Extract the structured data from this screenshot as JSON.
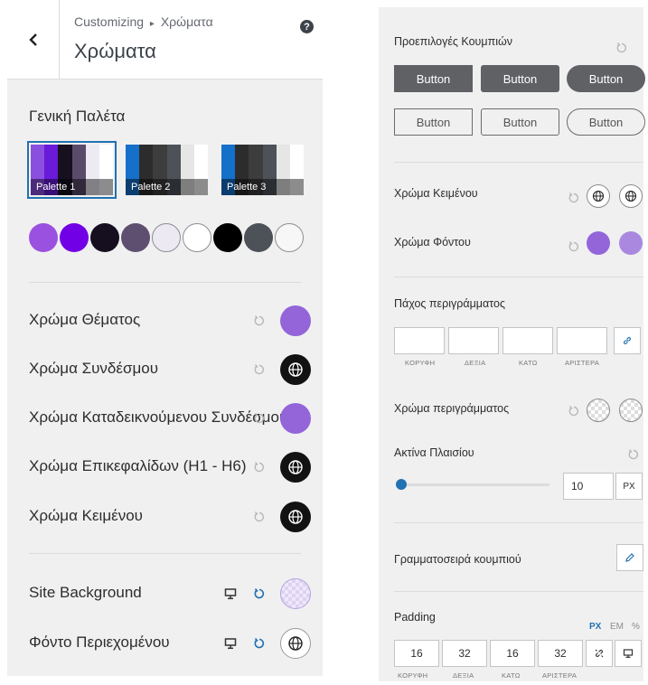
{
  "left": {
    "breadcrumb_root": "Customizing",
    "breadcrumb_sep": "▸",
    "breadcrumb_current": "Χρώματα",
    "title": "Χρώματα",
    "help": "?",
    "palette_section_title": "Γενική Παλέτα",
    "palettes": [
      {
        "label": "Palette 1",
        "colors": [
          "#8b4fe0",
          "#6a1ad9",
          "#16101f",
          "#5a4b6b",
          "#eeeaf3",
          "#ffffff"
        ],
        "selected": true
      },
      {
        "label": "Palette 2",
        "colors": [
          "#1570c9",
          "#2c2c2c",
          "#3d3d3d",
          "#4d5259",
          "#e6e6e6",
          "#ffffff"
        ],
        "selected": false
      },
      {
        "label": "Palette 3",
        "colors": [
          "#1570c9",
          "#2c2c2c",
          "#3d3d3d",
          "#4d5259",
          "#e6e6e6",
          "#ffffff"
        ],
        "selected": false
      }
    ],
    "palette_dots": [
      "#9b51e0",
      "#7200e6",
      "#150f1f",
      "#5e4f70",
      "#ece9f2",
      "#ffffff",
      "#000000",
      "#4d5258",
      "#f7f7f7"
    ],
    "color_rows": [
      {
        "label": "Χρώμα Θέματος",
        "swatch": "purple",
        "color": "#9365d9"
      },
      {
        "label": "Χρώμα Συνδέσμου",
        "swatch": "globe-dark"
      },
      {
        "label": "Χρώμα Καταδεικνούμενου Συνδέσμου",
        "swatch": "purple",
        "color": "#9365d9"
      },
      {
        "label": "Χρώμα Επικεφαλίδων (H1 - H6)",
        "swatch": "globe-dark"
      },
      {
        "label": "Χρώμα Κειμένου",
        "swatch": "globe-dark"
      }
    ],
    "bg_rows": [
      {
        "label": "Site Background",
        "swatch": "transparent-lilac"
      },
      {
        "label": "Φόντο Περιεχομένου",
        "swatch": "globe-white"
      }
    ]
  },
  "right": {
    "presets_title": "Προεπιλογές Κουμπιών",
    "button_label": "Button",
    "text_color_title": "Χρώμα Κειμένου",
    "bg_color_title": "Χρώμα Φόντου",
    "bg_color_value": "#9365d9",
    "border_width_title": "Πάχος περιγράμματος",
    "side_labels": [
      "ΚΟΡΥΦΗ",
      "ΔΕΞΙΑ",
      "ΚΑΤΩ",
      "ΑΡΙΣΤΕΡΑ"
    ],
    "border_color_title": "Χρώμα περιγράμματος",
    "radius_title": "Ακτίνα Πλαισίου",
    "radius_value": "10",
    "radius_unit": "PX",
    "font_title": "Γραμματοσειρά κουμπιού",
    "padding_title": "Padding",
    "units": [
      "PX",
      "EM",
      "%"
    ],
    "padding_values": [
      "16",
      "32",
      "16",
      "32"
    ],
    "accent": "#2271b1"
  }
}
